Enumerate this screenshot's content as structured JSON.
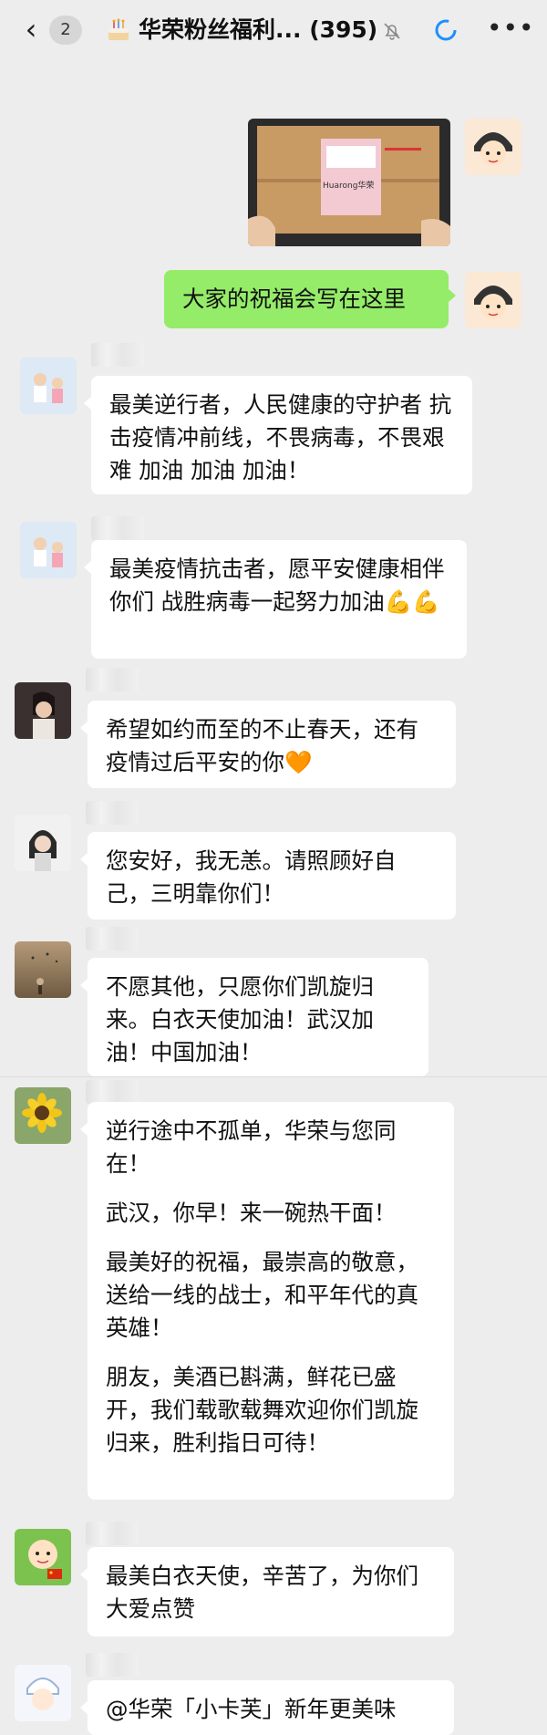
{
  "header": {
    "back_count": "2",
    "title": "华荣粉丝福利... (395)",
    "icons": [
      "back-chevron-icon",
      "cake-icon",
      "mute-bell-icon",
      "sync-icon",
      "more-icon"
    ]
  },
  "photo_message": {
    "box_brand": "Huarong华荣"
  },
  "self_message": {
    "text": "大家的祝福会写在这里",
    "bubble_color": "#95ec69"
  },
  "messages": [
    {
      "text": "最美逆行者，人民健康的守护者  抗击疫情冲前线，不畏病毒，不畏艰难 加油 加油 加油！"
    },
    {
      "text": "最美疫情抗击者，愿平安健康相伴你们  战胜病毒一起努力加油💪💪"
    },
    {
      "text": "希望如约而至的不止春天，还有疫情过后平安的你🧡"
    },
    {
      "text": "您安好，我无恙。请照顾好自己，三明靠你们！"
    },
    {
      "text": "不愿其他，只愿你们凯旋归来。白衣天使加油！武汉加油！中国加油！"
    },
    {
      "paragraphs": [
        "逆行途中不孤单，华荣与您同在！",
        "武汉，你早！来一碗热干面！",
        "最美好的祝福，最崇高的敬意，送给一线的战士，和平年代的真英雄！",
        "朋友，美酒已斟满，鲜花已盛开，我们载歌载舞欢迎你们凯旋归来，胜利指日可待！"
      ]
    },
    {
      "text": "最美白衣天使，辛苦了，为你们大爱点赞"
    },
    {
      "text": "@华荣「小卡芙」新年更美味"
    }
  ],
  "colors": {
    "background": "#ededed",
    "bubble": "#ffffff",
    "self_bubble": "#95ec69",
    "sync": "#1e90ff"
  }
}
